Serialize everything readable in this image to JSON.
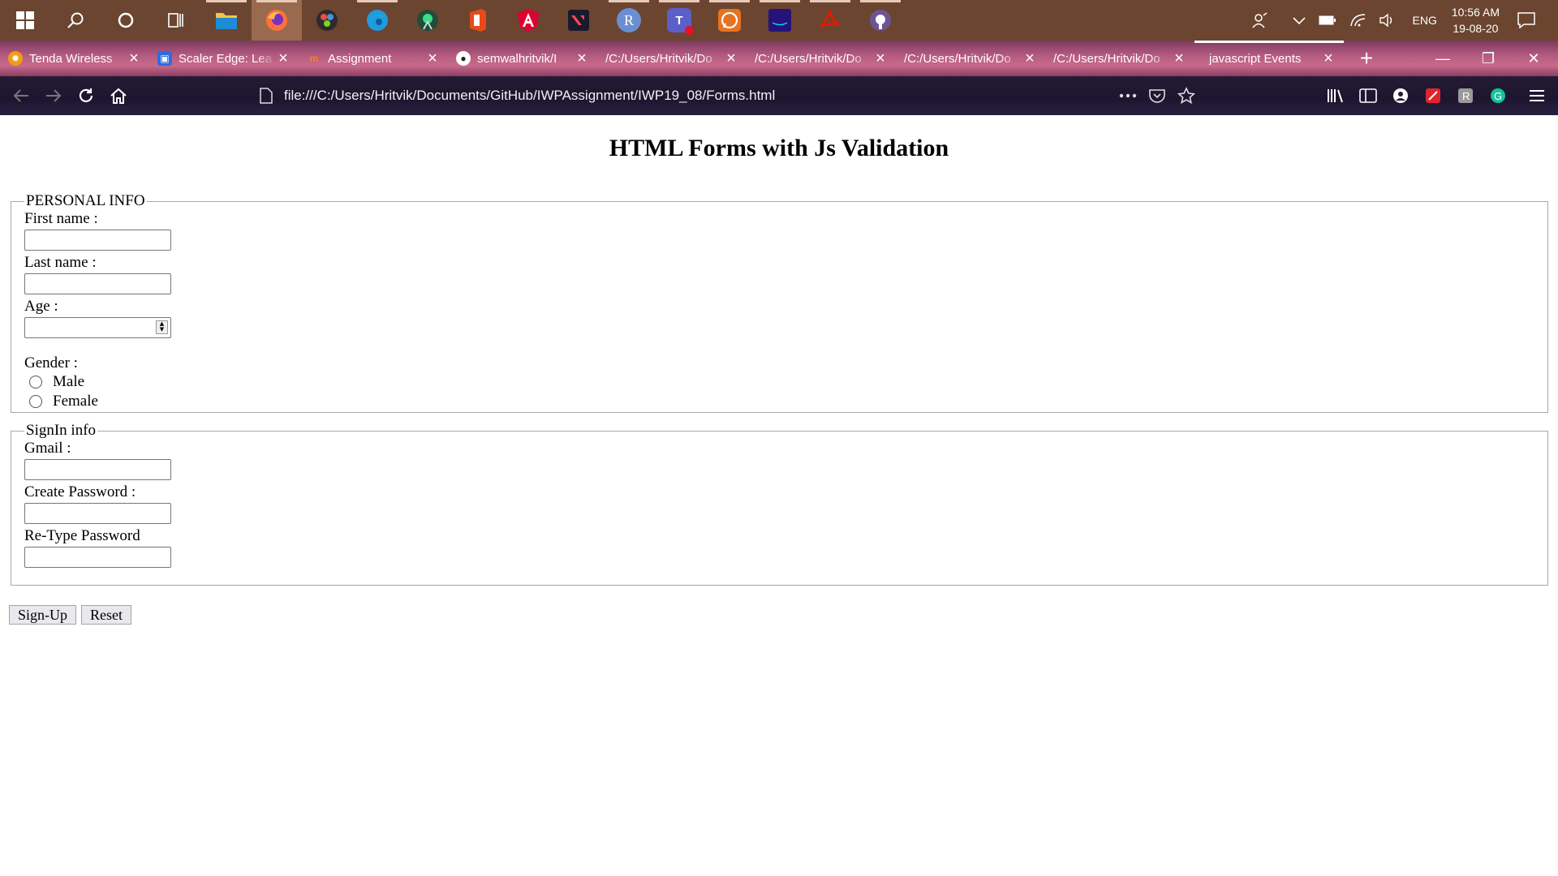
{
  "taskbar": {
    "apps": [
      {
        "name": "start-icon"
      },
      {
        "name": "search-icon"
      },
      {
        "name": "cortana-icon"
      },
      {
        "name": "task-view-icon"
      },
      {
        "name": "file-explorer-icon",
        "color": "#f4c542"
      },
      {
        "name": "firefox-icon",
        "color": "#ff7139",
        "active": true
      },
      {
        "name": "davinci-resolve-icon",
        "color": "#3a3a3a"
      },
      {
        "name": "edge-icon",
        "color": "#1f9be0"
      },
      {
        "name": "android-studio-icon",
        "color": "#3ddc84"
      },
      {
        "name": "office-icon",
        "color": "#e64a19"
      },
      {
        "name": "angular-icon",
        "color": "#dd0031"
      },
      {
        "name": "valorant-icon",
        "color": "#ff4655"
      },
      {
        "name": "profile-r-icon",
        "color": "#6a8fd1",
        "letter": "R"
      },
      {
        "name": "teams-icon",
        "color": "#5b5fc7",
        "letter": "T"
      },
      {
        "name": "whatsapp-icon",
        "color": "#25d366"
      },
      {
        "name": "amazon-music-icon",
        "color": "#25137a"
      },
      {
        "name": "acrobat-icon",
        "color": "#d81e05"
      },
      {
        "name": "github-icon",
        "color": "#6e5494"
      }
    ],
    "language": "ENG",
    "time": "10:56 AM",
    "date": "19-08-20"
  },
  "tabs": [
    {
      "title": "Tenda Wireless",
      "close": "×"
    },
    {
      "title": "Scaler Edge: Lea",
      "close": "×"
    },
    {
      "title": "Assignment",
      "close": "×"
    },
    {
      "title": "semwalhritvik/I",
      "close": "×"
    },
    {
      "title": "/C:/Users/Hritvik/Do",
      "close": "×"
    },
    {
      "title": "/C:/Users/Hritvik/Do",
      "close": "×"
    },
    {
      "title": "/C:/Users/Hritvik/Do",
      "close": "×"
    },
    {
      "title": "/C:/Users/Hritvik/Do",
      "close": "×"
    },
    {
      "title": "javascript Events",
      "close": "×",
      "selected": true
    }
  ],
  "new_tab_label": "+",
  "window_controls": {
    "minimize": "—",
    "restore": "❐",
    "close": "✕"
  },
  "url": "file:///C:/Users/Hritvik/Documents/GitHub/IWPAssignment/IWP19_08/Forms.html",
  "page": {
    "title": "HTML Forms with Js Validation",
    "personal": {
      "legend": "PERSONAL INFO",
      "first_name_label": "First name :",
      "last_name_label": "Last name :",
      "age_label": "Age :",
      "gender_label": "Gender :",
      "male_label": "Male",
      "female_label": "Female"
    },
    "signin": {
      "legend": "SignIn info",
      "gmail_label": "Gmail :",
      "password_label": "Create Password :",
      "retype_label": "Re-Type Password"
    },
    "signup_button": "Sign-Up",
    "reset_button": "Reset"
  }
}
